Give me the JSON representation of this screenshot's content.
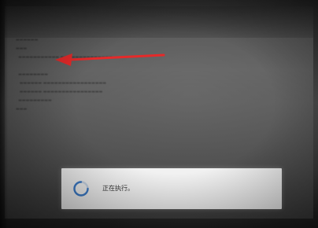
{
  "dialog": {
    "status_text": "正在执行。",
    "spinner_icon": "loading-spinner-icon",
    "accent_color": "#3d7cc9"
  },
  "annotation": {
    "arrow_icon": "red-arrow-icon",
    "arrow_color": "#e52a2a"
  }
}
